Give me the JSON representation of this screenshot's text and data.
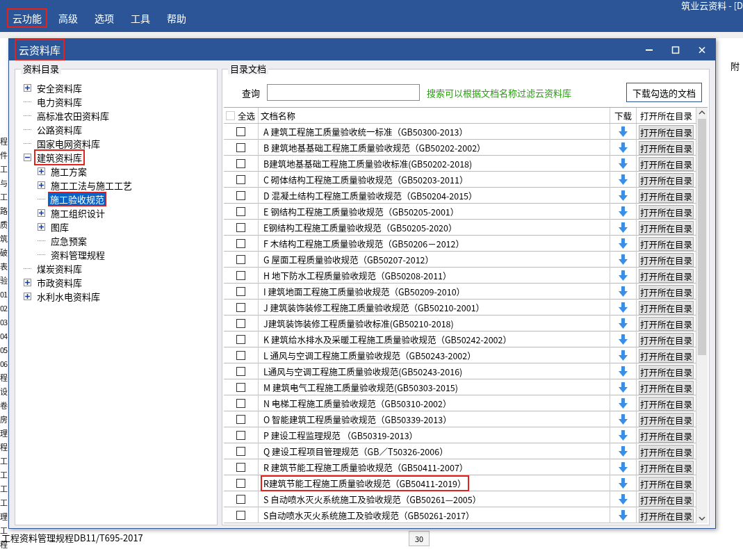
{
  "app": {
    "title": "筑业云资料 - [D",
    "menu": [
      {
        "label": "云功能",
        "highlighted": true
      },
      {
        "label": "高级",
        "highlighted": false
      },
      {
        "label": "选项",
        "highlighted": false
      },
      {
        "label": "工具",
        "highlighted": false
      },
      {
        "label": "帮助",
        "highlighted": false
      }
    ],
    "left_fragments": [
      "程",
      "件",
      "工",
      "与",
      "工",
      "路",
      "质",
      "筑",
      "破",
      "表",
      "验",
      "01",
      "02",
      "03",
      "04",
      "05",
      "06",
      "程",
      "设",
      "卷",
      "房",
      "理",
      "程",
      "工",
      "工",
      "工",
      "工",
      "理",
      "工",
      "程"
    ],
    "bottom_line": "工程资料管理规程DB11/T695-2017",
    "right_label": "附",
    "row_number": "30"
  },
  "dialog": {
    "title": "云资料库",
    "title_highlighted": true,
    "tree": {
      "legend": "资料目录",
      "items": [
        {
          "label": "安全资料库",
          "kind": "branch",
          "expanded": false,
          "selected": false,
          "highlighted": false
        },
        {
          "label": "电力资料库",
          "kind": "leaf",
          "selected": false,
          "highlighted": false
        },
        {
          "label": "高标准农田资料库",
          "kind": "leaf",
          "selected": false,
          "highlighted": false
        },
        {
          "label": "公路资料库",
          "kind": "leaf",
          "selected": false,
          "highlighted": false
        },
        {
          "label": "国家电网资料库",
          "kind": "leaf",
          "selected": false,
          "highlighted": false
        },
        {
          "label": "建筑资料库",
          "kind": "branch",
          "expanded": true,
          "selected": false,
          "highlighted": true,
          "children": [
            {
              "label": "施工方案",
              "kind": "branch",
              "expanded": false,
              "selected": false,
              "highlighted": false
            },
            {
              "label": "施工工法与施工工艺",
              "kind": "branch",
              "expanded": false,
              "selected": false,
              "highlighted": false
            },
            {
              "label": "施工验收规范",
              "kind": "leaf",
              "selected": true,
              "highlighted": true
            },
            {
              "label": "施工组织设计",
              "kind": "branch",
              "expanded": false,
              "selected": false,
              "highlighted": false
            },
            {
              "label": "图库",
              "kind": "branch",
              "expanded": false,
              "selected": false,
              "highlighted": false
            },
            {
              "label": "应急预案",
              "kind": "leaf",
              "selected": false,
              "highlighted": false
            },
            {
              "label": "资料管理规程",
              "kind": "leaf",
              "selected": false,
              "highlighted": false
            }
          ]
        },
        {
          "label": "煤炭资料库",
          "kind": "leaf",
          "selected": false,
          "highlighted": false
        },
        {
          "label": "市政资料库",
          "kind": "branch",
          "expanded": false,
          "selected": false,
          "highlighted": false
        },
        {
          "label": "水利水电资料库",
          "kind": "branch",
          "expanded": false,
          "selected": false,
          "highlighted": false
        }
      ]
    },
    "docs": {
      "legend": "目录文档",
      "search_label": "查询",
      "search_hint": "搜索可以根据文档名称过滤云资料库",
      "download_button": "下载勾选的文档",
      "columns": {
        "select_all": "全选",
        "select_all_checked": false,
        "name": "文档名称",
        "download": "下载",
        "open": "打开所在目录"
      },
      "rows": [
        {
          "name": "A 建筑工程施工质量验收统一标准（GB50300-2013）",
          "checked": false,
          "highlighted": false,
          "action": "打开所在目录"
        },
        {
          "name": "B 建筑地基基础工程施工质量验收规范（GB50202-2002）",
          "checked": false,
          "highlighted": false,
          "action": "打开所在目录"
        },
        {
          "name": "B建筑地基基础工程施工质量验收标准(GB50202-2018)",
          "checked": false,
          "highlighted": false,
          "action": "打开所在目录"
        },
        {
          "name": "C 砌体结构工程施工质量验收规范（GB50203-2011）",
          "checked": false,
          "highlighted": false,
          "action": "打开所在目录"
        },
        {
          "name": "D 混凝土结构工程施工质量验收规范（GB50204-2015）",
          "checked": false,
          "highlighted": false,
          "action": "打开所在目录"
        },
        {
          "name": "E 钢结构工程施工质量验收规范（GB50205-2001）",
          "checked": false,
          "highlighted": false,
          "action": "打开所在目录"
        },
        {
          "name": "E钢结构工程施工质量验收规范（GB50205-2020）",
          "checked": false,
          "highlighted": false,
          "action": "打开所在目录"
        },
        {
          "name": "F 木结构工程施工质量验收规范（GB50206－2012）",
          "checked": false,
          "highlighted": false,
          "action": "打开所在目录"
        },
        {
          "name": "G 屋面工程质量验收规范（GB50207-2012）",
          "checked": false,
          "highlighted": false,
          "action": "打开所在目录"
        },
        {
          "name": "H 地下防水工程质量验收规范（GB50208-2011）",
          "checked": false,
          "highlighted": false,
          "action": "打开所在目录"
        },
        {
          "name": "I 建筑地面工程施工质量验收规范（GB50209-2010）",
          "checked": false,
          "highlighted": false,
          "action": "打开所在目录"
        },
        {
          "name": "J 建筑装饰装修工程施工质量验收规范（GB50210-2001）",
          "checked": false,
          "highlighted": false,
          "action": "打开所在目录"
        },
        {
          "name": "J建筑装饰装修工程质量验收标准(GB50210-2018)",
          "checked": false,
          "highlighted": false,
          "action": "打开所在目录"
        },
        {
          "name": "K 建筑给水排水及采暖工程施工质量验收规范（GB50242-2002）",
          "checked": false,
          "highlighted": false,
          "action": "打开所在目录"
        },
        {
          "name": "L 通风与空调工程施工质量验收规范（GB50243-2002）",
          "checked": false,
          "highlighted": false,
          "action": "打开所在目录"
        },
        {
          "name": "L通风与空调工程施工质量验收规范(GB50243-2016)",
          "checked": false,
          "highlighted": false,
          "action": "打开所在目录"
        },
        {
          "name": "M 建筑电气工程施工质量验收规范(GB50303-2015)",
          "checked": false,
          "highlighted": false,
          "action": "打开所在目录"
        },
        {
          "name": "N 电梯工程施工质量验收规范（GB50310-2002）",
          "checked": false,
          "highlighted": false,
          "action": "打开所在目录"
        },
        {
          "name": "O 智能建筑工程质量验收规范（GB50339-2013）",
          "checked": false,
          "highlighted": false,
          "action": "打开所在目录"
        },
        {
          "name": "P 建设工程监理规范 （GB50319-2013）",
          "checked": false,
          "highlighted": false,
          "action": "打开所在目录"
        },
        {
          "name": "Q 建设工程项目管理规范（GB／T50326-2006）",
          "checked": false,
          "highlighted": false,
          "action": "打开所在目录"
        },
        {
          "name": "R 建筑节能工程施工质量验收规范（GB50411-2007）",
          "checked": false,
          "highlighted": false,
          "action": "打开所在目录"
        },
        {
          "name": "R建筑节能工程施工质量验收规范（GB50411-2019）",
          "checked": false,
          "highlighted": true,
          "action": "打开所在目录"
        },
        {
          "name": "S 自动喷水灭火系统施工及验收规范（GB50261—2005）",
          "checked": false,
          "highlighted": false,
          "action": "打开所在目录"
        },
        {
          "name": "S自动喷水灭火系统施工及验收规范（GB50261-2017）",
          "checked": false,
          "highlighted": false,
          "action": "打开所在目录"
        }
      ]
    }
  }
}
